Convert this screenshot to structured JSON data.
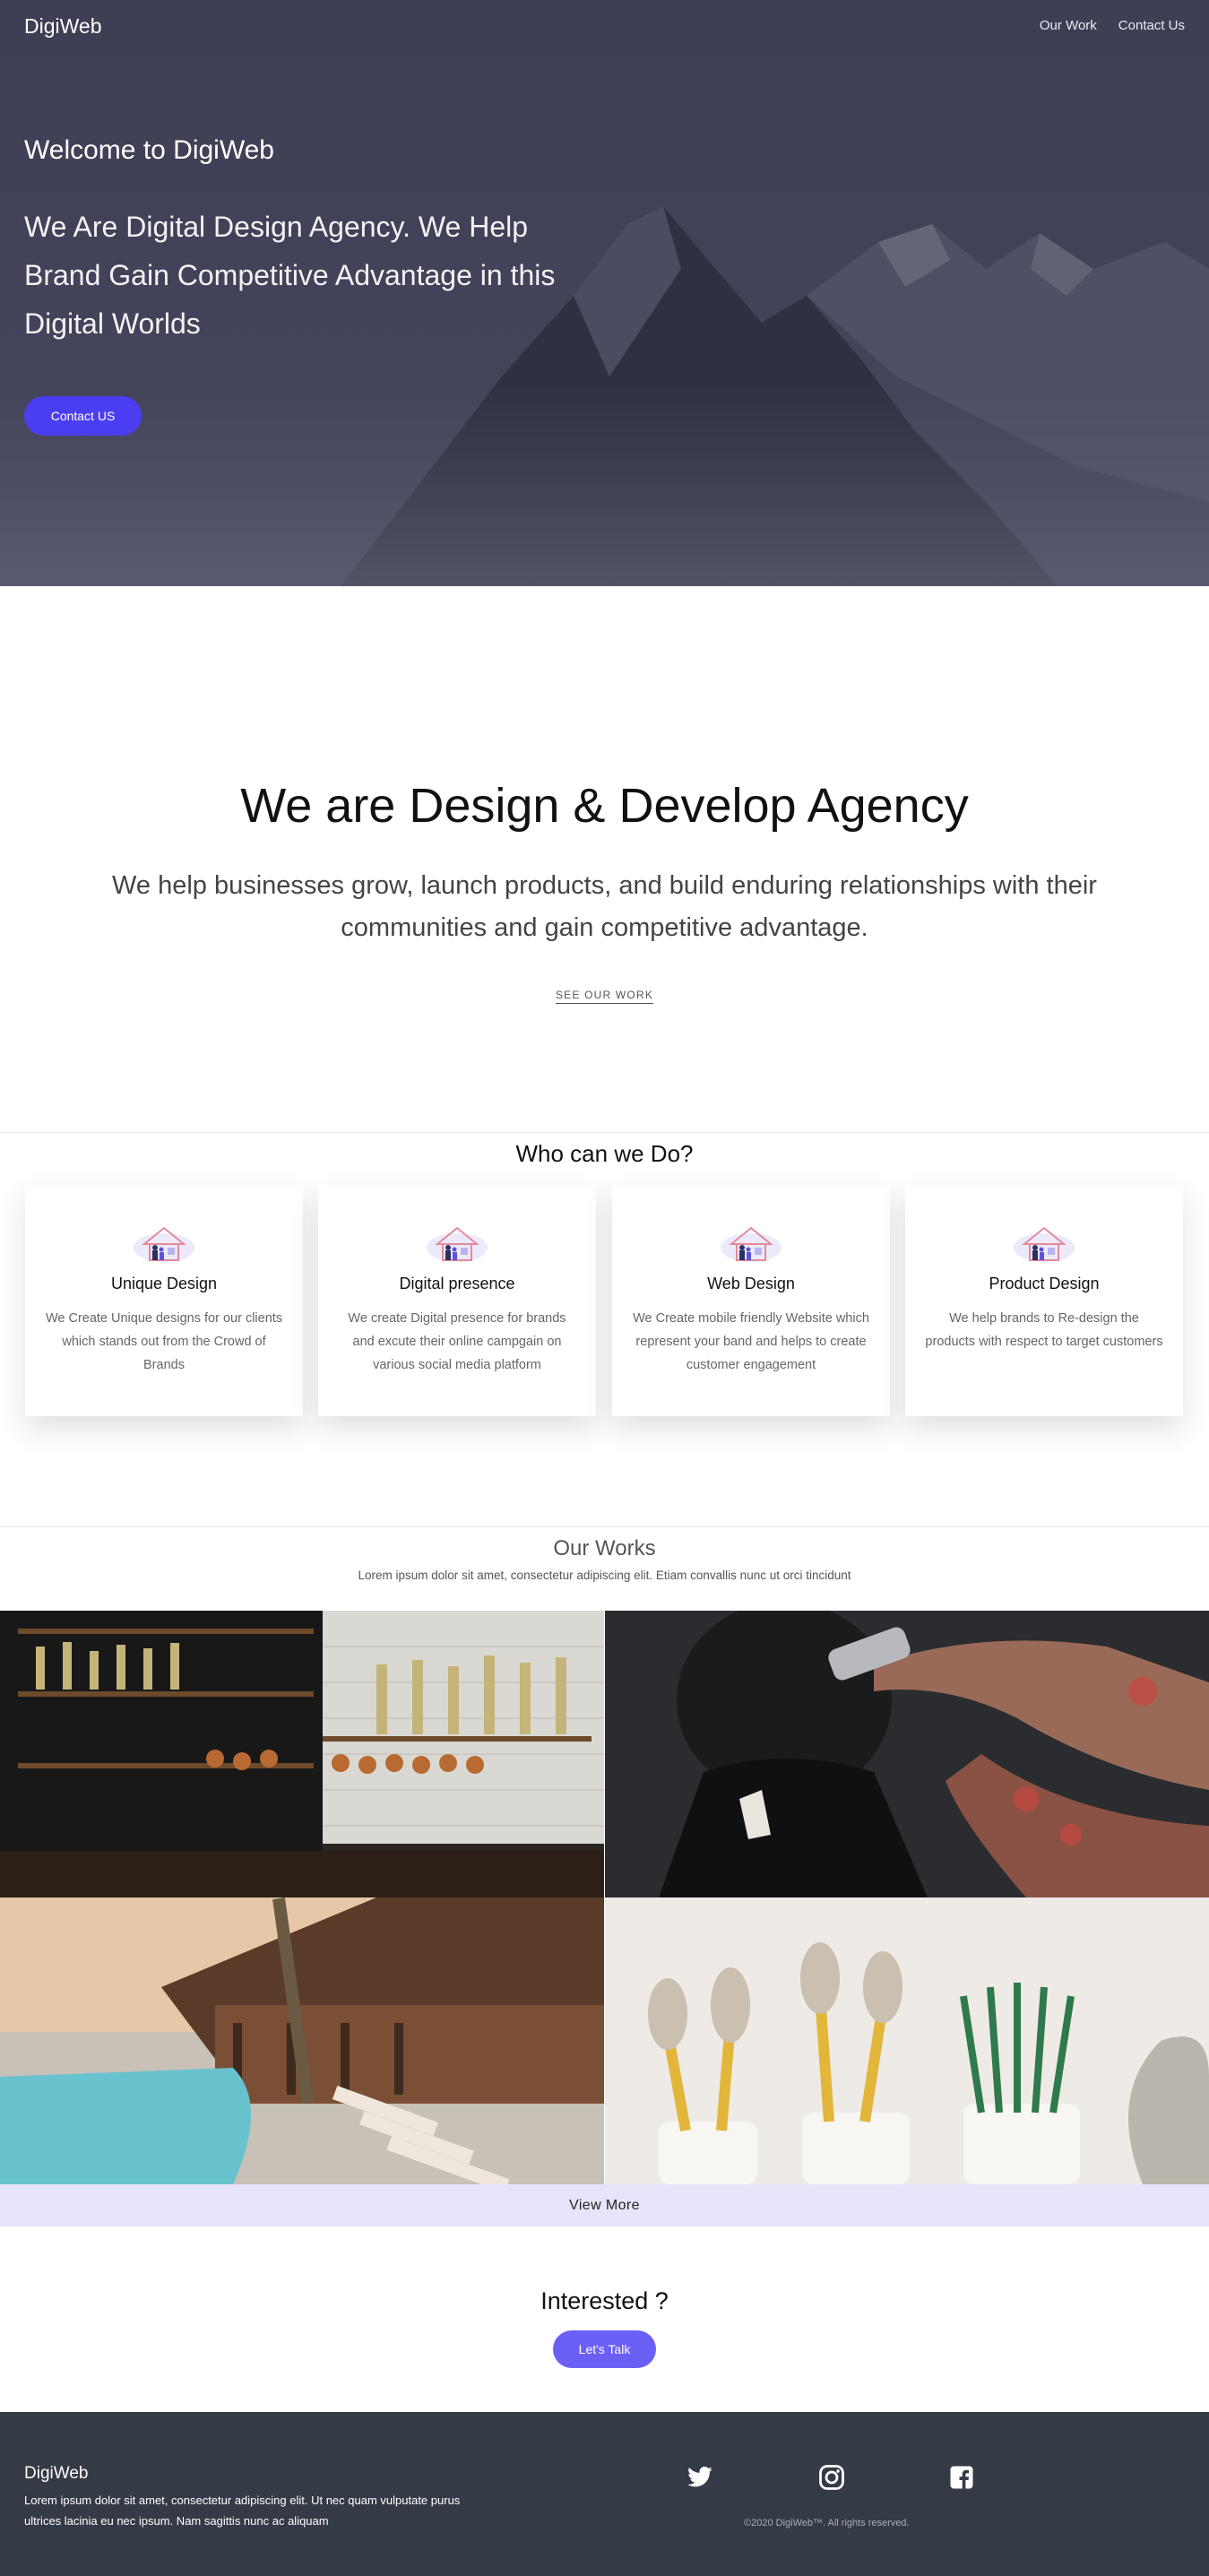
{
  "nav": {
    "brand": "DigiWeb",
    "links": [
      "Our Work",
      "Contact Us"
    ]
  },
  "hero": {
    "welcome": "Welcome to DigiWeb",
    "headline": "We Are Digital Design Agency. We Help Brand Gain Competitive Advantage in this Digital Worlds",
    "cta": "Contact US"
  },
  "about": {
    "title": "We are Design & Develop Agency",
    "text": "We help businesses grow, launch products, and build enduring relationships with their communities and gain competitive advantage.",
    "link": "SEE OUR WORK"
  },
  "services": {
    "title": "Who can we Do?",
    "items": [
      {
        "title": "Unique Design",
        "desc": "We Create Unique designs for our clients which stands out from the Crowd of Brands"
      },
      {
        "title": "Digital presence",
        "desc": "We create Digital presence for brands and excute their online campgain on various social media platform"
      },
      {
        "title": "Web Design",
        "desc": "We Create mobile friendly Website which represent your band and helps to create customer engagement"
      },
      {
        "title": "Product Design",
        "desc": "We help brands to Re-design the products with respect to target customers"
      }
    ]
  },
  "works": {
    "title": "Our Works",
    "subtitle": "Lorem ipsum dolor sit amet, consectetur adipiscing elit. Etiam convallis nunc ut orci tincidunt",
    "view_more": "View More"
  },
  "cta": {
    "title": "Interested ?",
    "button": "Let's Talk"
  },
  "footer": {
    "brand": "DigiWeb",
    "text": "Lorem ipsum dolor sit amet, consectetur adipiscing elit. Ut nec quam vulputate purus ultrices lacinia eu nec ipsum. Nam sagittis nunc ac aliquam",
    "copyright": "©2020 DigiWeb™. All rights reserved.",
    "social_icons": [
      "twitter-icon",
      "instagram-icon",
      "facebook-icon"
    ]
  },
  "colors": {
    "hero_overlay": "#3d3d52",
    "primary": "#4b3ef0",
    "talk_button": "#6c5ff5",
    "view_more_bg": "#e7e4fb",
    "footer_bg": "#343a46"
  }
}
